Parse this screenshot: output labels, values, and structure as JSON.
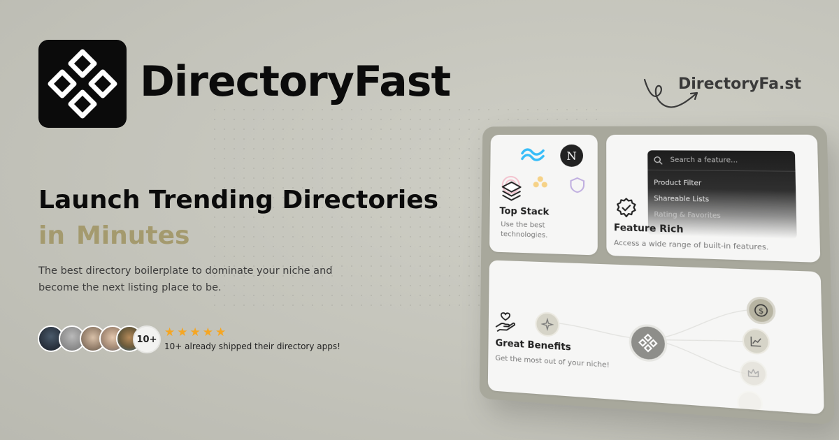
{
  "brand": {
    "name": "DirectoryFast",
    "signature": "DirectoryFa.st"
  },
  "hero": {
    "headline_line1": "Launch Trending Directories",
    "headline_line2_a": "in",
    "headline_line2_b": "Minutes",
    "subtitle": "The best directory boilerplate to dominate your niche and become the next listing place to be."
  },
  "social_proof": {
    "more_badge": "10+",
    "stars": 5,
    "caption": "10+ already shipped their directory apps!",
    "star_color": "#f5a623"
  },
  "mockup": {
    "top_stack": {
      "title": "Top Stack",
      "desc": "Use the best technologies."
    },
    "feature_rich": {
      "title": "Feature Rich",
      "desc": "Access a wide range of built-in features.",
      "search_placeholder": "Search a feature...",
      "options": [
        "Product Filter",
        "Shareable Lists",
        "Rating & Favorites"
      ]
    },
    "great_benefits": {
      "title": "Great Benefits",
      "desc": "Get the most out of your niche!"
    }
  },
  "colors": {
    "accent": "#a49a6e",
    "logo_bg": "#0b0b0b"
  }
}
